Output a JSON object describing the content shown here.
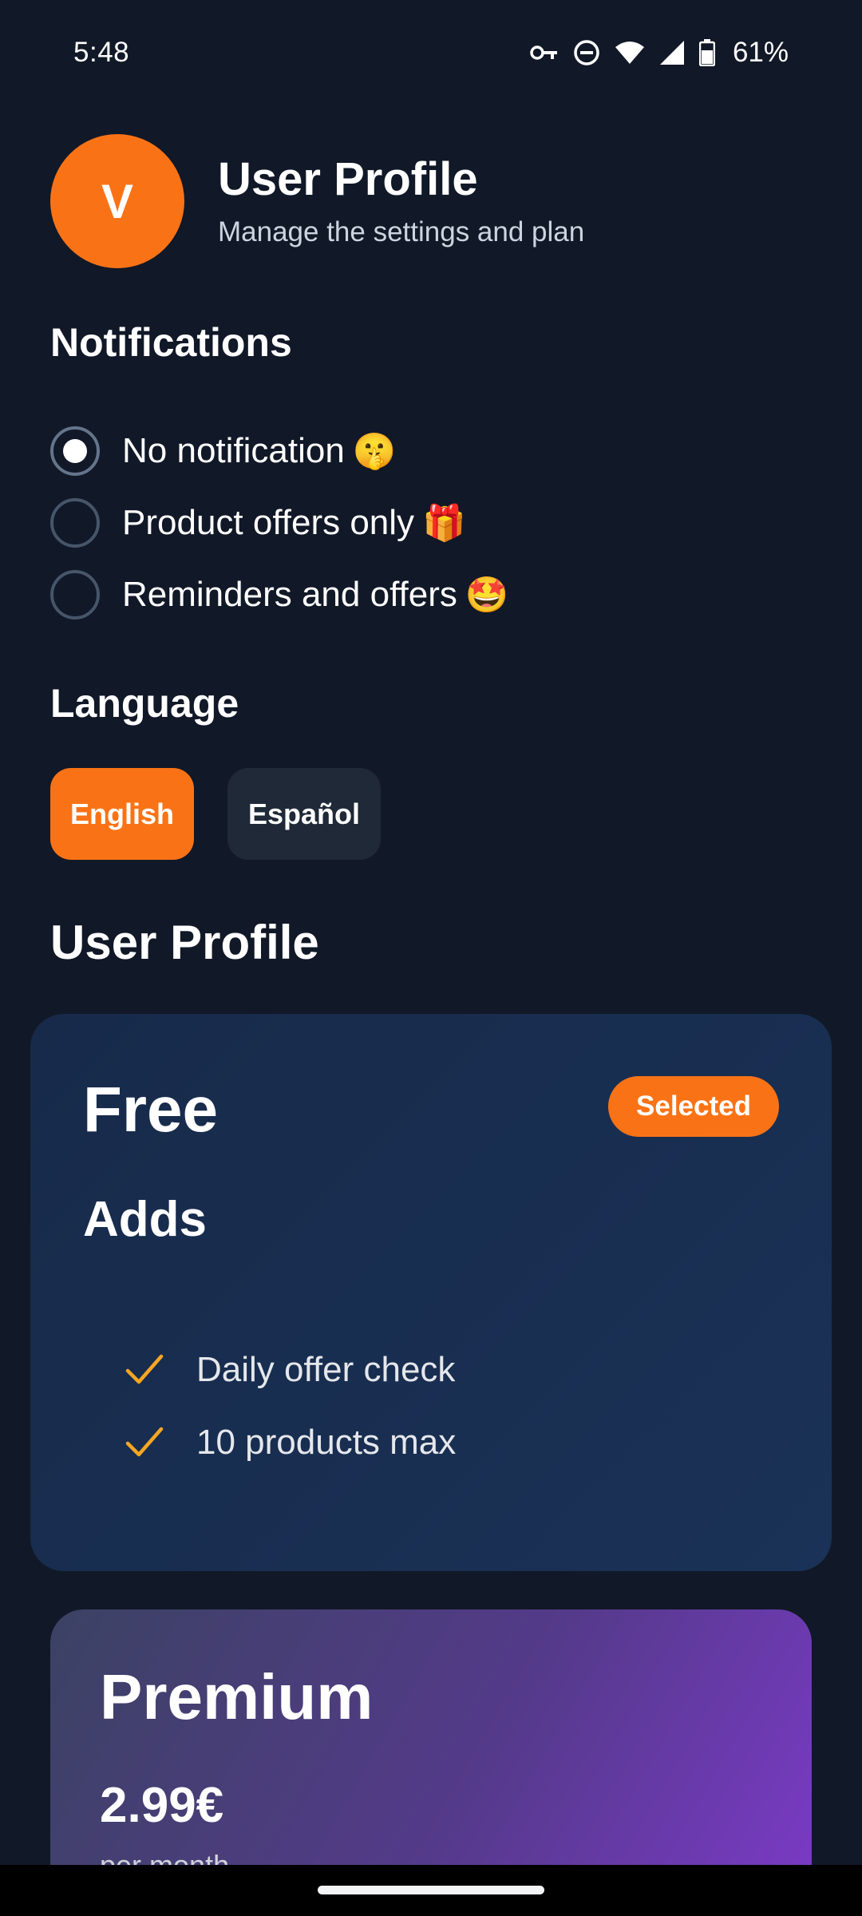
{
  "status_bar": {
    "time": "5:48",
    "battery": "61%"
  },
  "header": {
    "avatar_initial": "V",
    "title": "User Profile",
    "subtitle": "Manage the settings and plan"
  },
  "notifications": {
    "title": "Notifications",
    "options": [
      {
        "label": "No notification",
        "emoji": "🤫",
        "selected": true
      },
      {
        "label": "Product offers only",
        "emoji": "🎁",
        "selected": false
      },
      {
        "label": "Reminders and offers",
        "emoji": "🤩",
        "selected": false
      }
    ]
  },
  "language": {
    "title": "Language",
    "options": [
      {
        "label": "English",
        "selected": true
      },
      {
        "label": "Español",
        "selected": false
      }
    ]
  },
  "profile_section": {
    "title": "User Profile"
  },
  "plans": {
    "free": {
      "name": "Free",
      "badge": "Selected",
      "price": "Adds",
      "features": [
        "Daily offer check",
        "10 products max"
      ]
    },
    "premium": {
      "name": "Premium",
      "price": "2.99€",
      "period": "per month"
    }
  },
  "colors": {
    "background": "#111827",
    "accent": "#f97316",
    "check": "#f5a623"
  }
}
